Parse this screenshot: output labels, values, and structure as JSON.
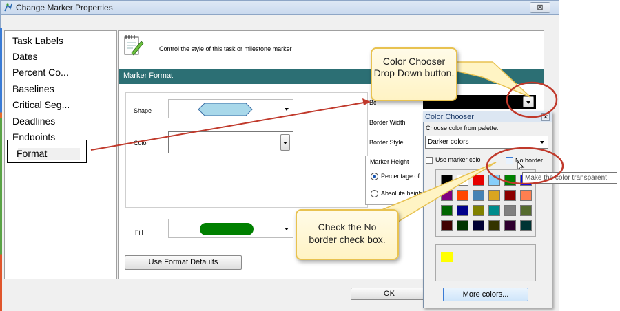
{
  "window": {
    "title": "Change Marker Properties",
    "close_glyph": "⊠"
  },
  "nav": {
    "items": [
      "Task Labels",
      "Dates",
      "Percent Co...",
      "Baselines",
      "Critical Seg...",
      "Deadlines",
      "Endpoints",
      "Format"
    ],
    "selected": "Format"
  },
  "header": {
    "description": "Control the style of this task or milestone marker",
    "icon": "notepad-pencil-icon"
  },
  "section": {
    "title": "Marker Format"
  },
  "form": {
    "shape_label": "Shape",
    "color_label": "Color",
    "border_color_label": "Border Color",
    "border_width_label": "Border Width",
    "border_style_label": "Border Style",
    "marker_height_label": "Marker Height",
    "percentage_label": "Percentage of",
    "absolute_label": "Absolute heigh",
    "fill_label": "Fill",
    "defaults_button": "Use Format Defaults",
    "ok_button": "OK"
  },
  "color_chooser": {
    "title": "Color Chooser",
    "subtitle": "Choose color from palette:",
    "palette_select": "Darker colors",
    "use_marker_label": "Use marker colo",
    "no_border_label": "No border",
    "tooltip": "Make the color transparent",
    "more_colors_button": "More colors...",
    "current_color": "#ffff00",
    "swatches": [
      [
        "#000000",
        "#ffffff",
        "#e60000",
        "#87cefa",
        "#008000",
        "#0000ff"
      ],
      [
        "#800080",
        "#ff4500",
        "#4682b4",
        "#daa520",
        "#8b0000",
        "#ff7f50"
      ],
      [
        "#006400",
        "#00008b",
        "#808000",
        "#008b8b",
        "#808080",
        "#556b2f"
      ],
      [
        "#3f0000",
        "#003300",
        "#000033",
        "#333300",
        "#2f002f",
        "#003333"
      ]
    ]
  },
  "callouts": {
    "dropdown": "Color Chooser Drop Down button.",
    "no_border": "Check the No border check box."
  },
  "colors": {
    "accent_band": "#2c6f74",
    "shape_fill": "#a8d8ea",
    "fill_green": "#008000",
    "callout_border": "#e8c250",
    "annotation_red": "#c0392b"
  }
}
